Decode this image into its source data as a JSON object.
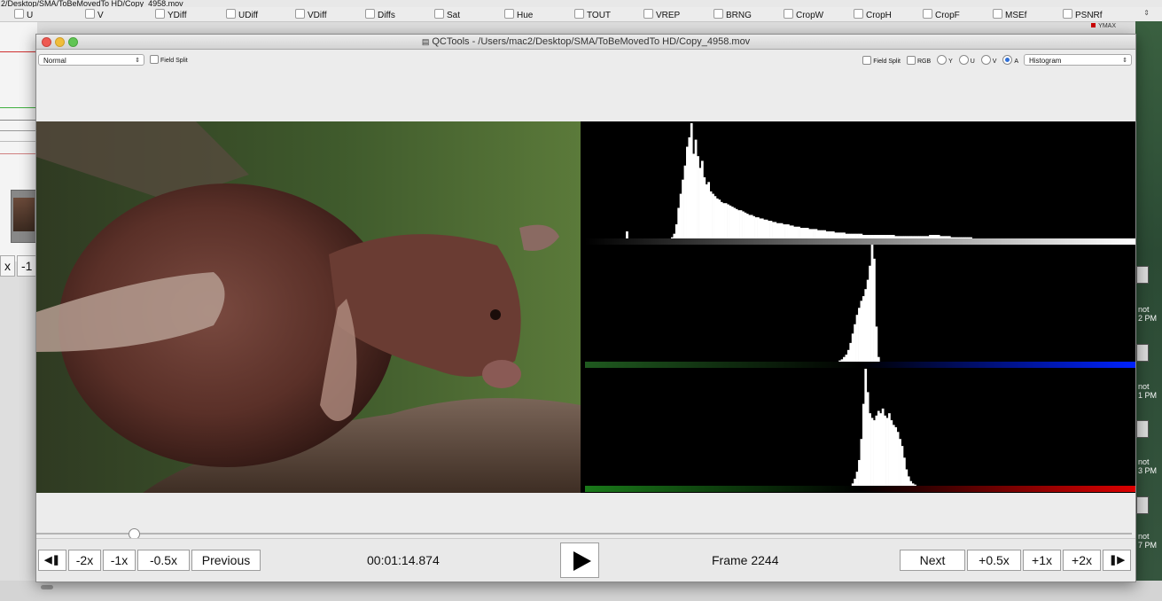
{
  "background_window": {
    "path": "2/Desktop/SMA/ToBeMovedTo HD/Copy_4958.mov",
    "filters": [
      "U",
      "V",
      "YDiff",
      "UDiff",
      "VDiff",
      "Diffs",
      "Sat",
      "Hue",
      "TOUT",
      "VREP",
      "BRNG",
      "CropW",
      "CropH",
      "CropF",
      "MSEf",
      "PSNRf"
    ],
    "legend_label": "YMAX",
    "left_controls": [
      "x",
      "-1"
    ],
    "desktop_labels": [
      "not",
      "2 PM",
      "not",
      "1 PM",
      "not",
      "3 PM",
      "not",
      "7 PM"
    ]
  },
  "window": {
    "title": "QCTools - /Users/mac2/Desktop/SMA/ToBeMovedTo HD/Copy_4958.mov"
  },
  "left_toolbar": {
    "mode_select": "Normal",
    "field_split_label": "Field Split"
  },
  "right_toolbar": {
    "field_split_label": "Field Split",
    "channels": [
      {
        "label": "RGB",
        "kind": "checkbox",
        "selected": false
      },
      {
        "label": "Y",
        "kind": "radio",
        "selected": false
      },
      {
        "label": "U",
        "kind": "radio",
        "selected": false
      },
      {
        "label": "V",
        "kind": "radio",
        "selected": false
      },
      {
        "label": "A",
        "kind": "radio",
        "selected": true
      }
    ],
    "view_select": "Histogram"
  },
  "controls": {
    "prev_frame_icon": "step-back-icon",
    "speed_back": [
      "-2x",
      "-1x",
      "-0.5x"
    ],
    "previous_label": "Previous",
    "timecode": "00:01:14.874",
    "play_icon": "play-icon",
    "frame_label": "Frame 2244",
    "next_label": "Next",
    "speed_forward": [
      "+0.5x",
      "+1x",
      "+2x"
    ],
    "next_frame_icon": "step-forward-icon"
  },
  "colors": {
    "selected_radio": "#2f6fd6",
    "legend_red": "#cc0000",
    "hist_bar": "#ffffff"
  },
  "histograms": {
    "y_plane": [
      0,
      0,
      0,
      0,
      0,
      0,
      0,
      0,
      0,
      0,
      0,
      0,
      0,
      0,
      0,
      0,
      0,
      0,
      0,
      6,
      0,
      0,
      0,
      0,
      0,
      0,
      0,
      0,
      0,
      0,
      0,
      0,
      0,
      0,
      0,
      0,
      0,
      0,
      0,
      0,
      1,
      4,
      12,
      26,
      38,
      50,
      62,
      78,
      86,
      98,
      72,
      84,
      70,
      60,
      66,
      52,
      46,
      48,
      40,
      38,
      36,
      34,
      33,
      31,
      30,
      30,
      29,
      28,
      27,
      26,
      25,
      24,
      24,
      23,
      22,
      21,
      20,
      20,
      19,
      18,
      18,
      17,
      17,
      16,
      16,
      15,
      15,
      14,
      14,
      13,
      13,
      13,
      12,
      12,
      12,
      11,
      11,
      10,
      10,
      10,
      9,
      9,
      9,
      9,
      8,
      8,
      8,
      8,
      7,
      7,
      7,
      7,
      6,
      6,
      6,
      6,
      5,
      5,
      5,
      5,
      5,
      4,
      4,
      4,
      4,
      4,
      4,
      4,
      4,
      3,
      3,
      3,
      3,
      3,
      3,
      3,
      3,
      3,
      3,
      3,
      3,
      3,
      3,
      3,
      2,
      2,
      2,
      2,
      2,
      2,
      2,
      2,
      2,
      2,
      2,
      2,
      2,
      2,
      2,
      2,
      3,
      3,
      3,
      3,
      3,
      2,
      2,
      2,
      2,
      2,
      1,
      1,
      1,
      1,
      1,
      1,
      1,
      1,
      1,
      1,
      0,
      0,
      0,
      0,
      0,
      0,
      0,
      0,
      0,
      0,
      0,
      0,
      0,
      0,
      0,
      0,
      0,
      0,
      0,
      0,
      0,
      0,
      0,
      0,
      0,
      0,
      0,
      0,
      0,
      0,
      0,
      0,
      0,
      0,
      0,
      0,
      0,
      0,
      0,
      0,
      0,
      0,
      0,
      0,
      0,
      0,
      0,
      0,
      0,
      0,
      0,
      0,
      0,
      0,
      0,
      0,
      0,
      0,
      0,
      0,
      0,
      0,
      0,
      0,
      0,
      0,
      0,
      0,
      0,
      0,
      0,
      0,
      0,
      0,
      0,
      0,
      0,
      0,
      0,
      0,
      0,
      0,
      0,
      0,
      0,
      0,
      0,
      0,
      0,
      0,
      0,
      0,
      0,
      0,
      0
    ],
    "u_plane": [
      0,
      0,
      0,
      0,
      0,
      0,
      0,
      0,
      0,
      0,
      0,
      0,
      0,
      0,
      0,
      0,
      0,
      0,
      0,
      0,
      0,
      0,
      0,
      0,
      0,
      0,
      0,
      0,
      0,
      0,
      0,
      0,
      0,
      0,
      0,
      0,
      0,
      0,
      0,
      0,
      0,
      0,
      0,
      0,
      0,
      0,
      0,
      0,
      0,
      0,
      0,
      0,
      0,
      0,
      0,
      0,
      0,
      0,
      0,
      0,
      0,
      0,
      0,
      0,
      0,
      0,
      0,
      0,
      0,
      0,
      0,
      0,
      0,
      0,
      0,
      0,
      0,
      0,
      0,
      0,
      0,
      0,
      0,
      0,
      0,
      0,
      0,
      0,
      0,
      0,
      0,
      0,
      0,
      0,
      0,
      0,
      0,
      0,
      0,
      0,
      0,
      0,
      0,
      0,
      0,
      0,
      0,
      0,
      0,
      0,
      0,
      0,
      0,
      0,
      0,
      0,
      0,
      0,
      1,
      2,
      4,
      6,
      10,
      16,
      24,
      32,
      40,
      46,
      52,
      56,
      62,
      70,
      82,
      100,
      88,
      30,
      4,
      0,
      0,
      0,
      0,
      0,
      0,
      0,
      0,
      0,
      0,
      0,
      0,
      0,
      0,
      0,
      0,
      0,
      0,
      0,
      0,
      0,
      0,
      0,
      0,
      0,
      0,
      0,
      0,
      0,
      0,
      0,
      0,
      0,
      0,
      0,
      0,
      0,
      0,
      0,
      0,
      0,
      0,
      0,
      0,
      0,
      0,
      0,
      0,
      0,
      0,
      0,
      0,
      0,
      0,
      0,
      0,
      0,
      0,
      0,
      0,
      0,
      0,
      0,
      0,
      0,
      0,
      0,
      0,
      0,
      0,
      0,
      0,
      0,
      0,
      0,
      0,
      0,
      0,
      0,
      0,
      0,
      0,
      0,
      0,
      0,
      0,
      0,
      0,
      0,
      0,
      0,
      0,
      0,
      0,
      0,
      0,
      0,
      0,
      0,
      0,
      0,
      0,
      0,
      0,
      0,
      0,
      0,
      0,
      0,
      0,
      0,
      0,
      0,
      0,
      0,
      0,
      0,
      0,
      0,
      0,
      0,
      0,
      0,
      0,
      0,
      0,
      0,
      0,
      0,
      0,
      0
    ],
    "v_plane": [
      0,
      0,
      0,
      0,
      0,
      0,
      0,
      0,
      0,
      0,
      0,
      0,
      0,
      0,
      0,
      0,
      0,
      0,
      0,
      0,
      0,
      0,
      0,
      0,
      0,
      0,
      0,
      0,
      0,
      0,
      0,
      0,
      0,
      0,
      0,
      0,
      0,
      0,
      0,
      0,
      0,
      0,
      0,
      0,
      0,
      0,
      0,
      0,
      0,
      0,
      0,
      0,
      0,
      0,
      0,
      0,
      0,
      0,
      0,
      0,
      0,
      0,
      0,
      0,
      0,
      0,
      0,
      0,
      0,
      0,
      0,
      0,
      0,
      0,
      0,
      0,
      0,
      0,
      0,
      0,
      0,
      0,
      0,
      0,
      0,
      0,
      0,
      0,
      0,
      0,
      0,
      0,
      0,
      0,
      0,
      0,
      0,
      0,
      0,
      0,
      0,
      0,
      0,
      0,
      0,
      0,
      0,
      0,
      0,
      0,
      0,
      0,
      0,
      0,
      0,
      0,
      0,
      0,
      0,
      0,
      0,
      0,
      0,
      0,
      2,
      6,
      12,
      22,
      40,
      70,
      100,
      80,
      62,
      58,
      56,
      60,
      64,
      62,
      66,
      60,
      58,
      62,
      56,
      52,
      50,
      46,
      40,
      34,
      24,
      14,
      8,
      4,
      2,
      1,
      0,
      0,
      0,
      0,
      0,
      0,
      0,
      0,
      0,
      0,
      0,
      0,
      0,
      0,
      0,
      0,
      0,
      0,
      0,
      0,
      0,
      0,
      0,
      0,
      0,
      0,
      0,
      0,
      0,
      0,
      0,
      0,
      0,
      0,
      0,
      0,
      0,
      0,
      0,
      0,
      0,
      0,
      0,
      0,
      0,
      0,
      0,
      0,
      0,
      0,
      0,
      0,
      0,
      0,
      0,
      0,
      0,
      0,
      0,
      0,
      0,
      0,
      0,
      0,
      0,
      0,
      0,
      0,
      0,
      0,
      0,
      0,
      0,
      0,
      0,
      0,
      0,
      0,
      0,
      0,
      0,
      0,
      0,
      0,
      0,
      0,
      0,
      0,
      0,
      0,
      0,
      0,
      0,
      0,
      0,
      0,
      0,
      0,
      0,
      0,
      0,
      0,
      0,
      0,
      0,
      0,
      0,
      0,
      0,
      0,
      0,
      0,
      0,
      0,
      0,
      0,
      0,
      0,
      0
    ]
  }
}
